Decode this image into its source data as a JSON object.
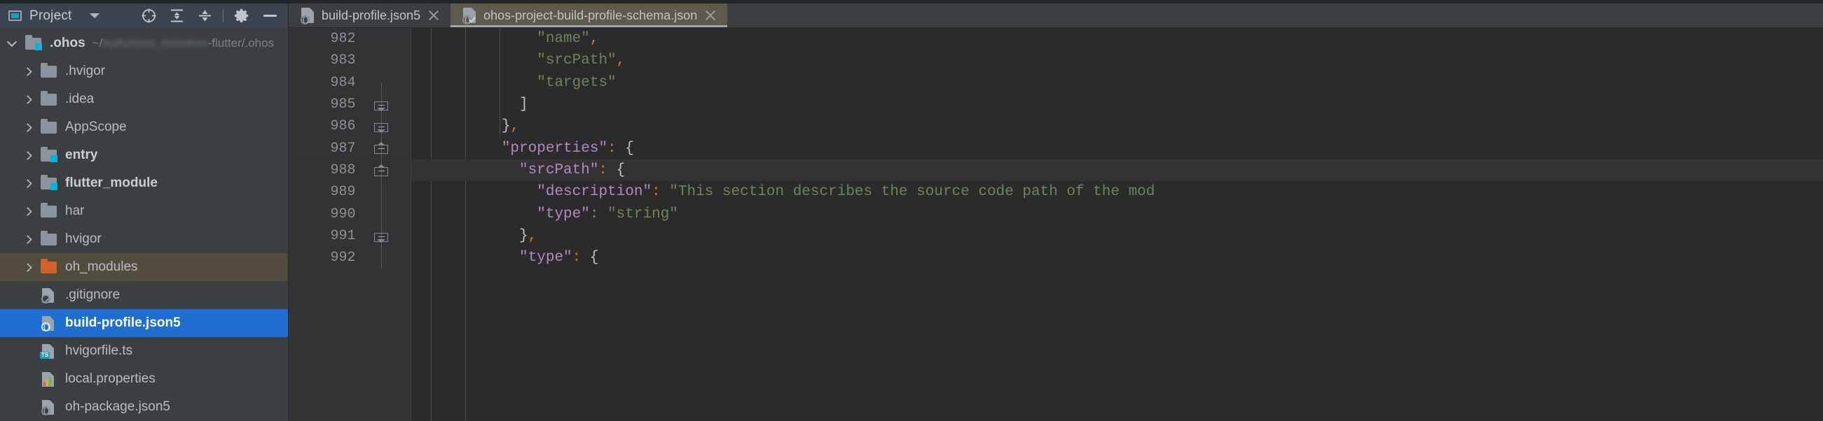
{
  "window": {
    "theme_bg": "#2b2b2b",
    "accent_selected": "#1f6fd0",
    "accent_cyan": "#00b4e0"
  },
  "sidebar": {
    "header": {
      "icon": "project-panel-icon",
      "title": "Project",
      "dropdown_icon": "chevron-down-icon",
      "buttons": [
        {
          "name": "select-opened-file-icon",
          "label": ""
        },
        {
          "name": "expand-all-icon",
          "label": ""
        },
        {
          "name": "collapse-all-icon",
          "label": ""
        },
        {
          "name": "settings-gear-icon",
          "label": ""
        },
        {
          "name": "hide-panel-icon",
          "label": ""
        }
      ]
    },
    "tree": [
      {
        "depth": 0,
        "twisty": "expanded",
        "icon": "folder-module-icon",
        "label": ".ohos",
        "bold": true,
        "path_prefix": "~/",
        "path_blurred": "huifu/moo_morohos",
        "path_suffix": "-flutter/.ohos",
        "state": "normal"
      },
      {
        "depth": 1,
        "twisty": "collapsed",
        "icon": "folder-icon",
        "label": ".hvigor",
        "bold": false,
        "state": "normal"
      },
      {
        "depth": 1,
        "twisty": "collapsed",
        "icon": "folder-icon",
        "label": ".idea",
        "bold": false,
        "state": "normal"
      },
      {
        "depth": 1,
        "twisty": "collapsed",
        "icon": "folder-icon",
        "label": "AppScope",
        "bold": false,
        "state": "normal"
      },
      {
        "depth": 1,
        "twisty": "collapsed",
        "icon": "folder-module-icon",
        "label": "entry",
        "bold": true,
        "state": "normal"
      },
      {
        "depth": 1,
        "twisty": "collapsed",
        "icon": "folder-module-icon",
        "label": "flutter_module",
        "bold": true,
        "state": "normal"
      },
      {
        "depth": 1,
        "twisty": "collapsed",
        "icon": "folder-icon",
        "label": "har",
        "bold": false,
        "state": "normal"
      },
      {
        "depth": 1,
        "twisty": "collapsed",
        "icon": "folder-icon",
        "label": "hvigor",
        "bold": false,
        "state": "normal"
      },
      {
        "depth": 1,
        "twisty": "collapsed",
        "icon": "folder-excluded-icon",
        "label": "oh_modules",
        "bold": false,
        "state": "highlighted"
      },
      {
        "depth": 1,
        "twisty": "none",
        "icon": "file-gitignore-icon",
        "label": ".gitignore",
        "bold": false,
        "state": "normal"
      },
      {
        "depth": 1,
        "twisty": "none",
        "icon": "file-json5-icon",
        "label": "build-profile.json5",
        "bold": false,
        "state": "selected"
      },
      {
        "depth": 1,
        "twisty": "none",
        "icon": "file-typescript-icon",
        "label": "hvigorfile.ts",
        "bold": false,
        "state": "normal",
        "tag": "TS"
      },
      {
        "depth": 1,
        "twisty": "none",
        "icon": "file-properties-icon",
        "label": "local.properties",
        "bold": false,
        "state": "normal"
      },
      {
        "depth": 1,
        "twisty": "none",
        "icon": "file-json5-icon",
        "label": "oh-package.json5",
        "bold": false,
        "state": "normal"
      }
    ]
  },
  "editor": {
    "tabs": [
      {
        "icon": "file-json5-icon",
        "label": "build-profile.json5",
        "close_icon": "close-icon",
        "active": false
      },
      {
        "icon": "file-json-schema-icon",
        "label": "ohos-project-build-profile-schema.json",
        "close_icon": "close-icon",
        "active": true
      }
    ],
    "current_line": 988,
    "lines": [
      {
        "number": 982,
        "fold": "none",
        "tokens": [
          {
            "t": "            ",
            "c": "s-pun"
          },
          {
            "t": "\"name\"",
            "c": "s-str"
          },
          {
            "t": ",",
            "c": "s-com"
          }
        ]
      },
      {
        "number": 983,
        "fold": "none",
        "tokens": [
          {
            "t": "            ",
            "c": "s-pun"
          },
          {
            "t": "\"srcPath\"",
            "c": "s-str"
          },
          {
            "t": ",",
            "c": "s-com"
          }
        ]
      },
      {
        "number": 984,
        "fold": "none",
        "tokens": [
          {
            "t": "            ",
            "c": "s-pun"
          },
          {
            "t": "\"targets\"",
            "c": "s-str"
          }
        ]
      },
      {
        "number": 985,
        "fold": "up",
        "tokens": [
          {
            "t": "          ",
            "c": "s-pun"
          },
          {
            "t": "]",
            "c": "s-brc"
          }
        ]
      },
      {
        "number": 986,
        "fold": "up",
        "tokens": [
          {
            "t": "        ",
            "c": "s-pun"
          },
          {
            "t": "}",
            "c": "s-brc"
          },
          {
            "t": ",",
            "c": "s-com"
          }
        ]
      },
      {
        "number": 987,
        "fold": "down",
        "tokens": [
          {
            "t": "        ",
            "c": "s-pun"
          },
          {
            "t": "\"properties\"",
            "c": "s-key"
          },
          {
            "t": ":",
            "c": "s-com"
          },
          {
            "t": " {",
            "c": "s-brc"
          }
        ]
      },
      {
        "number": 988,
        "fold": "down",
        "current": true,
        "tokens": [
          {
            "t": "          ",
            "c": "s-pun"
          },
          {
            "t": "\"srcPath\"",
            "c": "s-key"
          },
          {
            "t": ":",
            "c": "s-com"
          },
          {
            "t": " {",
            "c": "s-brc"
          }
        ]
      },
      {
        "number": 989,
        "fold": "none",
        "tokens": [
          {
            "t": "            ",
            "c": "s-pun"
          },
          {
            "t": "\"description\"",
            "c": "s-key"
          },
          {
            "t": ":",
            "c": "s-com"
          },
          {
            "t": " \"This section describes the source code path of the mod",
            "c": "s-str"
          }
        ]
      },
      {
        "number": 990,
        "fold": "none",
        "tokens": [
          {
            "t": "            ",
            "c": "s-pun"
          },
          {
            "t": "\"type\"",
            "c": "s-key"
          },
          {
            "t": ":",
            "c": "s-com"
          },
          {
            "t": " ",
            "c": "s-pun"
          },
          {
            "t": "\"string\"",
            "c": "s-str"
          }
        ]
      },
      {
        "number": 991,
        "fold": "up",
        "tokens": [
          {
            "t": "          ",
            "c": "s-pun"
          },
          {
            "t": "}",
            "c": "s-brc"
          },
          {
            "t": ",",
            "c": "s-com"
          }
        ]
      },
      {
        "number": 992,
        "fold": "down",
        "partial": true,
        "tokens": [
          {
            "t": "          ",
            "c": "s-pun"
          },
          {
            "t": "\"type\"",
            "c": "s-key"
          },
          {
            "t": ":",
            "c": "s-com"
          },
          {
            "t": " {",
            "c": "s-brc"
          }
        ]
      }
    ]
  }
}
